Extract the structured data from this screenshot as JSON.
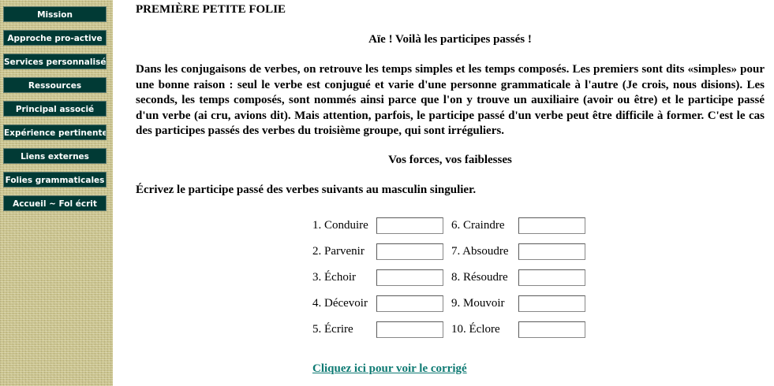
{
  "sidebar": {
    "items": [
      {
        "label": "Mission"
      },
      {
        "label": "Approche pro-active"
      },
      {
        "label": "Services personnalisés"
      },
      {
        "label": "Ressources"
      },
      {
        "label": "Principal associé"
      },
      {
        "label": "Expérience pertinente"
      },
      {
        "label": "Liens externes"
      },
      {
        "label": "Folies grammaticales"
      },
      {
        "label": "Accueil ~ Fol écrit"
      }
    ]
  },
  "page": {
    "title": "PREMIÈRE PETITE FOLIE",
    "subtitle": "Aïe ! Voilà les participes passés !",
    "intro": "Dans les conjugaisons de verbes, on retrouve les temps simples et les temps composés. Les premiers sont dits «simples» pour une bonne raison : seul le verbe est conjugué et varie d'une personne grammaticale à l'autre (Je crois, nous disions). Les seconds, les temps composés, sont nommés ainsi parce que l'on y trouve un auxiliaire (avoir ou être) et le participe passé d'un verbe (ai cru, avions dit). Mais attention, parfois, le participe passé d'un verbe peut être difficile à former. C'est le cas des participes passés des verbes du troisième groupe, qui sont irréguliers.",
    "subtitle2": "Vos forces, vos faiblesses",
    "instruction": "Écrivez le participe passé des verbes suivants au masculin singulier."
  },
  "exercise": {
    "left": [
      {
        "label": "1. Conduire",
        "value": ""
      },
      {
        "label": "2. Parvenir",
        "value": ""
      },
      {
        "label": "3. Échoir",
        "value": ""
      },
      {
        "label": "4. Décevoir",
        "value": ""
      },
      {
        "label": "5. Écrire",
        "value": ""
      }
    ],
    "right": [
      {
        "label": "6. Craindre",
        "value": ""
      },
      {
        "label": "7. Absoudre",
        "value": ""
      },
      {
        "label": "8. Résoudre",
        "value": ""
      },
      {
        "label": "9. Mouvoir",
        "value": ""
      },
      {
        "label": "10. Éclore",
        "value": ""
      }
    ]
  },
  "links": {
    "correction": "Cliquez ici pour voir le corrigé"
  },
  "colors": {
    "nav_button_bg": "#013a35",
    "sidebar_texture": "#c9c28c",
    "link": "#0e7a73"
  }
}
